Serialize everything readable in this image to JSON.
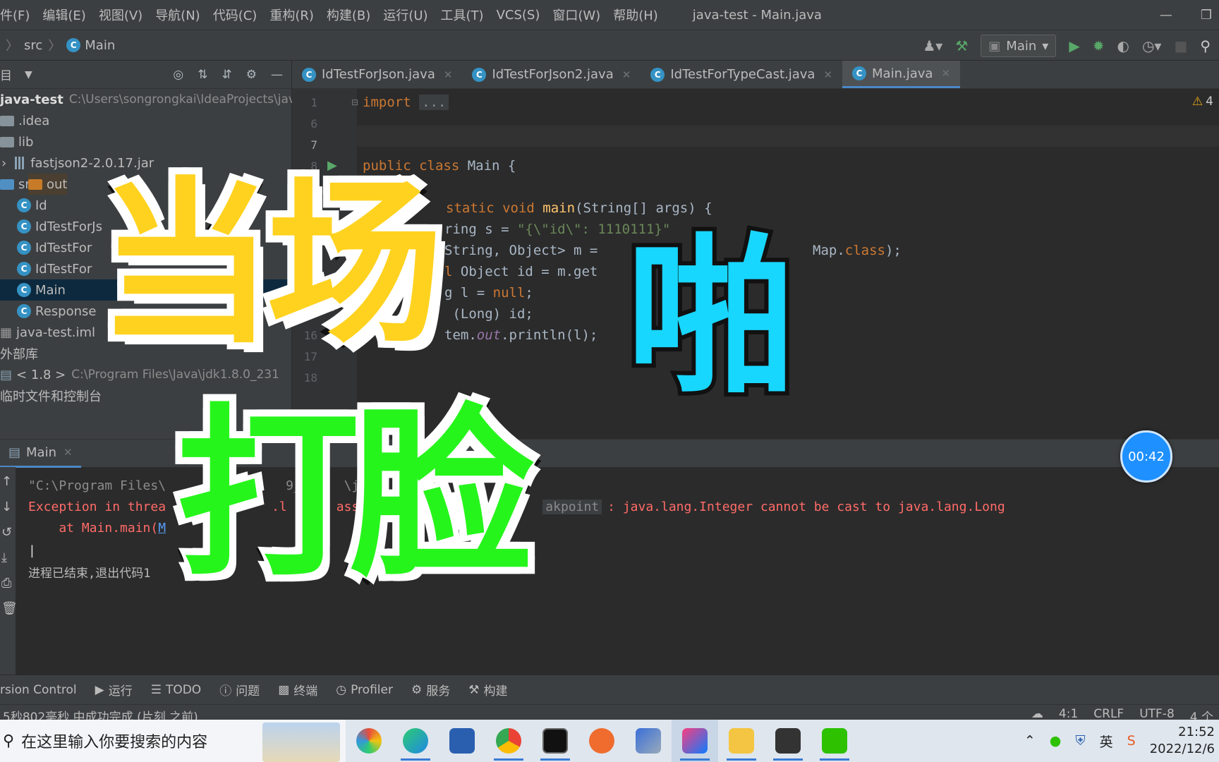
{
  "menu": {
    "items": [
      "件(F)",
      "编辑(E)",
      "视图(V)",
      "导航(N)",
      "代码(C)",
      "重构(R)",
      "构建(B)",
      "运行(U)",
      "工具(T)",
      "VCS(S)",
      "窗口(W)",
      "帮助(H)"
    ],
    "window_title": "java-test - Main.java"
  },
  "breadcrumb": {
    "folder": "src",
    "file": "Main"
  },
  "run_config": {
    "name": "Main"
  },
  "project": {
    "header": "目",
    "root_name": "java-test",
    "root_path": "C:\\Users\\songrongkai\\IdeaProjects\\java",
    "items": [
      ".idea",
      "lib",
      "fastjson2-2.0.17.jar",
      "out",
      "src",
      "Id",
      "IdTestForJs",
      "IdTestFor",
      "IdTestFor",
      "Main",
      "Response",
      "java-test.iml",
      "外部库"
    ],
    "jdk_label": "< 1.8 >",
    "jdk_path": "C:\\Program Files\\Java\\jdk1.8.0_231",
    "scratch": "临时文件和控制台"
  },
  "tabs": [
    {
      "label": "IdTestForJson.java"
    },
    {
      "label": "IdTestForJson2.java"
    },
    {
      "label": "IdTestForTypeCast.java"
    },
    {
      "label": "Main.java"
    }
  ],
  "editor": {
    "line_numbers": [
      "1",
      "6",
      "7",
      "8",
      "16",
      "17",
      "18"
    ],
    "warning_count": "4",
    "import_kw": "import",
    "import_fold": "...",
    "class_decl_kw": "public class",
    "class_name": "Main {",
    "main_kw": "static void",
    "main_fn": "main",
    "main_args": "(String[] args) {",
    "line_str_decl": "ring s = ",
    "line_str_val": "\"{\\\"id\\\": 1110111}\"",
    "line_map": "String, Object> m = ",
    "line_map_end": "Map.",
    "line_map_class": "class",
    "line_map_tail": ");",
    "line_obj_kw": "l",
    "line_obj": " Object id = m.get",
    "line_long": "g l = ",
    "line_long_null": "null",
    "line_long_end": ";",
    "line_cast": " (Long) id;",
    "line_print_pre": "tem.",
    "line_print_out": "out",
    "line_print_post": ".println(l);"
  },
  "run": {
    "tab_label": "Main",
    "cmd_line": "\"C:\\Program Files\\",
    "cmd_tail": "9_2",
    "cmd_tail2": "\\ja",
    "exception_head": "Exception in threa",
    "exception_mid": ".l",
    "exception_mid2": "ass",
    "breakpoint": "akpoint",
    "exception_msg": ": java.lang.Integer cannot be cast to java.lang.Long",
    "stack_line": "    at Main.main(",
    "stack_link": "M",
    "exit_msg": "进程已结束,退出代码1"
  },
  "overlay": {
    "caption_1": "当场",
    "caption_2": "啪",
    "caption_3": "打脸",
    "timer": "00:42"
  },
  "toolwindows": [
    "rsion Control",
    "运行",
    "TODO",
    "问题",
    "终端",
    "Profiler",
    "服务",
    "构建"
  ],
  "status": {
    "left": "5秒802毫秒 中成功完成 (片刻 之前)",
    "position": "4:1",
    "line_sep": "CRLF",
    "encoding": "UTF-8",
    "indent": "4 个"
  },
  "taskbar": {
    "search_placeholder": "在这里输入你要搜索的内容",
    "ime": "英",
    "time": "21:52",
    "date": "2022/12/6"
  }
}
